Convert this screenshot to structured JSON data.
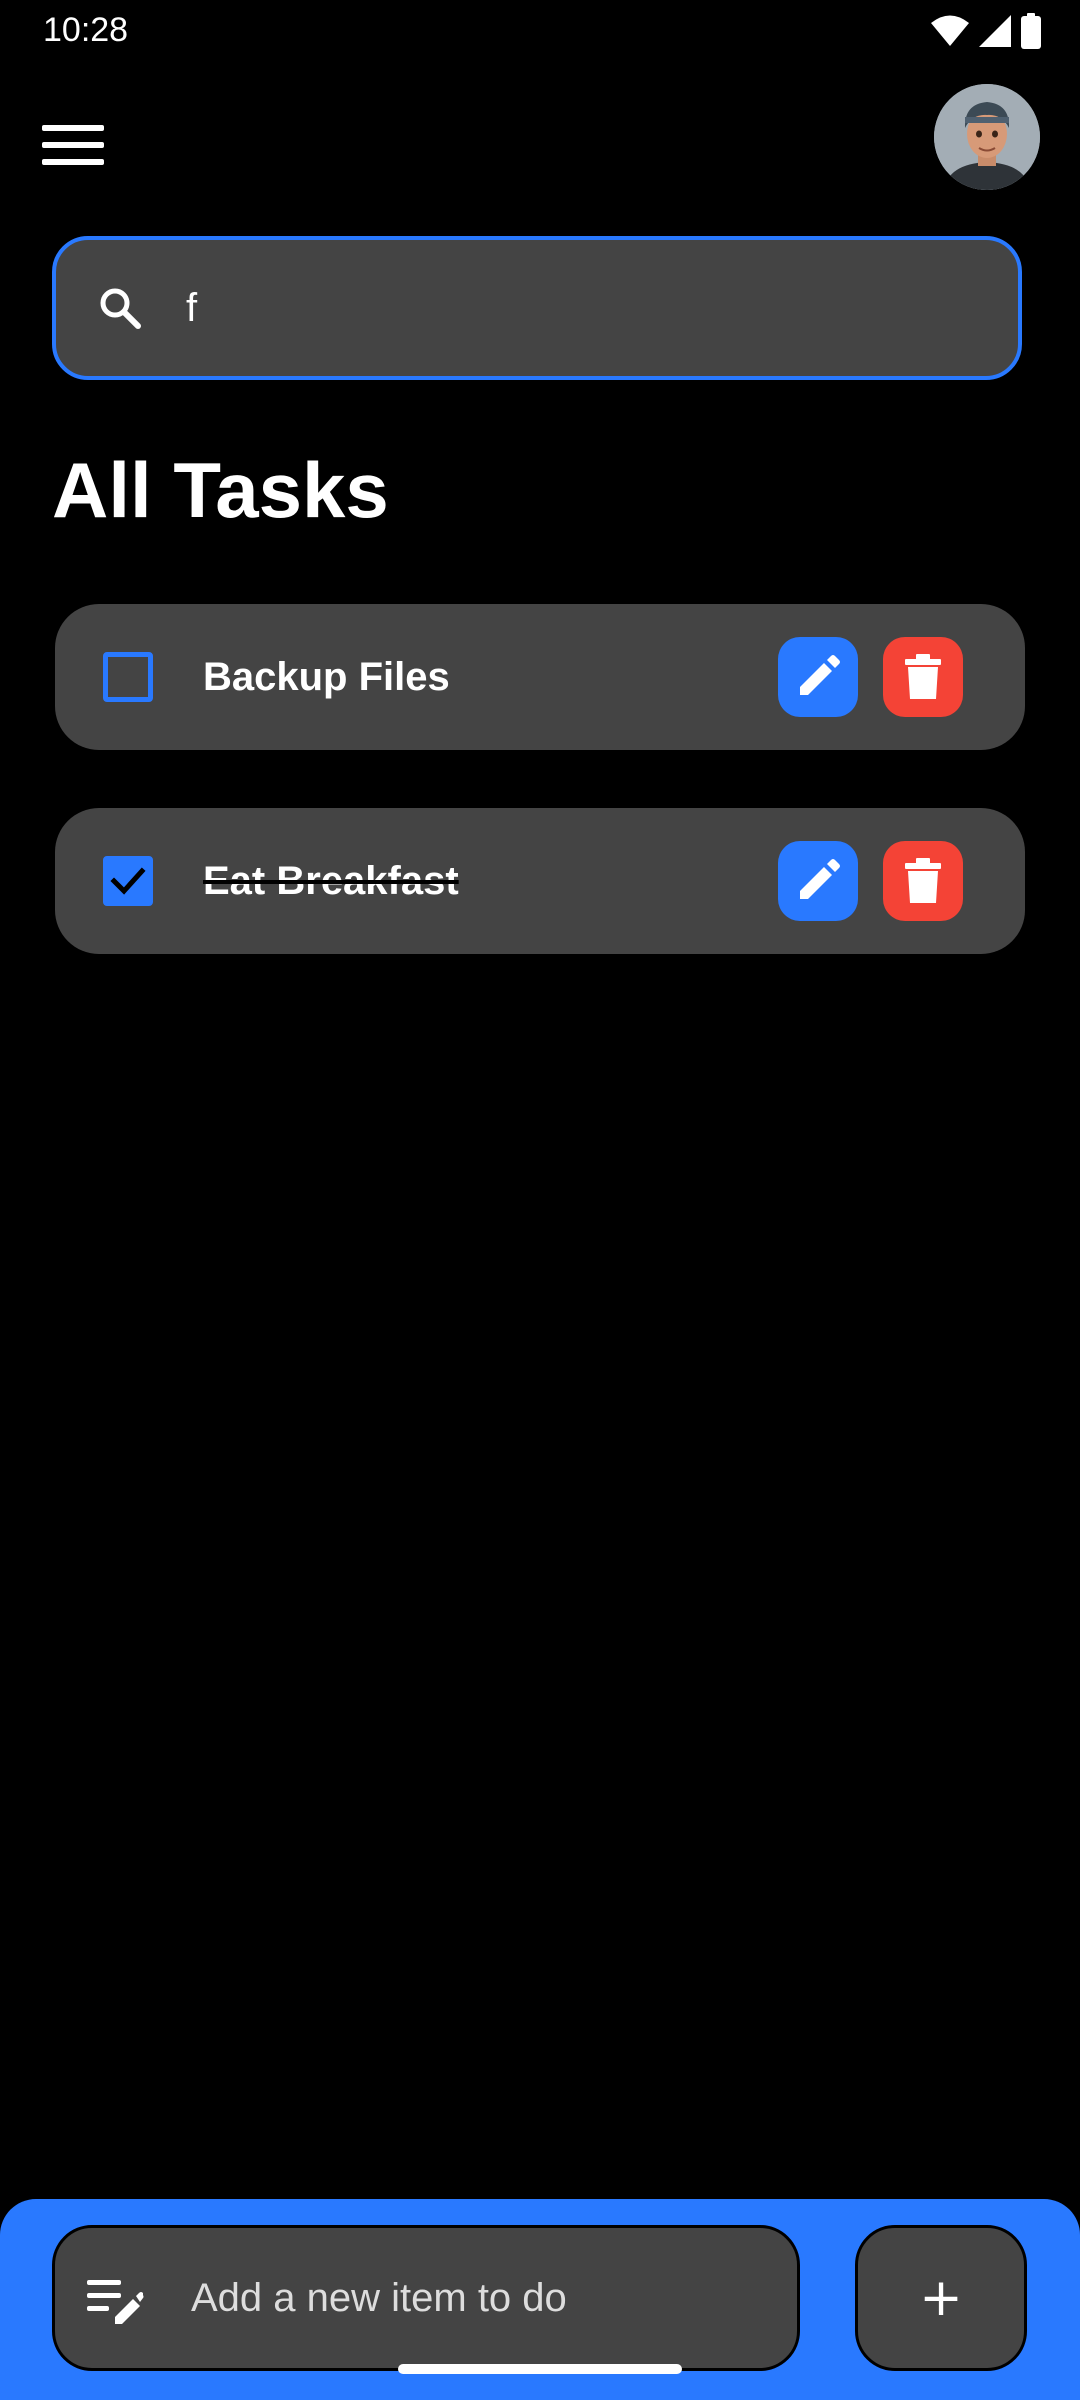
{
  "status_bar": {
    "time": "10:28",
    "icons": [
      "wifi-icon",
      "signal-icon",
      "battery-icon"
    ]
  },
  "app_bar": {
    "menu_icon": "hamburger-menu-icon",
    "avatar": "user-avatar"
  },
  "search": {
    "value": "f",
    "icon": "search-icon"
  },
  "page": {
    "title": "All Tasks"
  },
  "tasks": [
    {
      "label": "Backup Files",
      "done": false
    },
    {
      "label": "Eat Breakfast",
      "done": true
    }
  ],
  "add_bar": {
    "placeholder": "Add a new item to do",
    "add_label": "+"
  },
  "colors": {
    "accent": "#2979ff",
    "danger": "#f44336",
    "card": "#444444",
    "background": "#000000"
  }
}
